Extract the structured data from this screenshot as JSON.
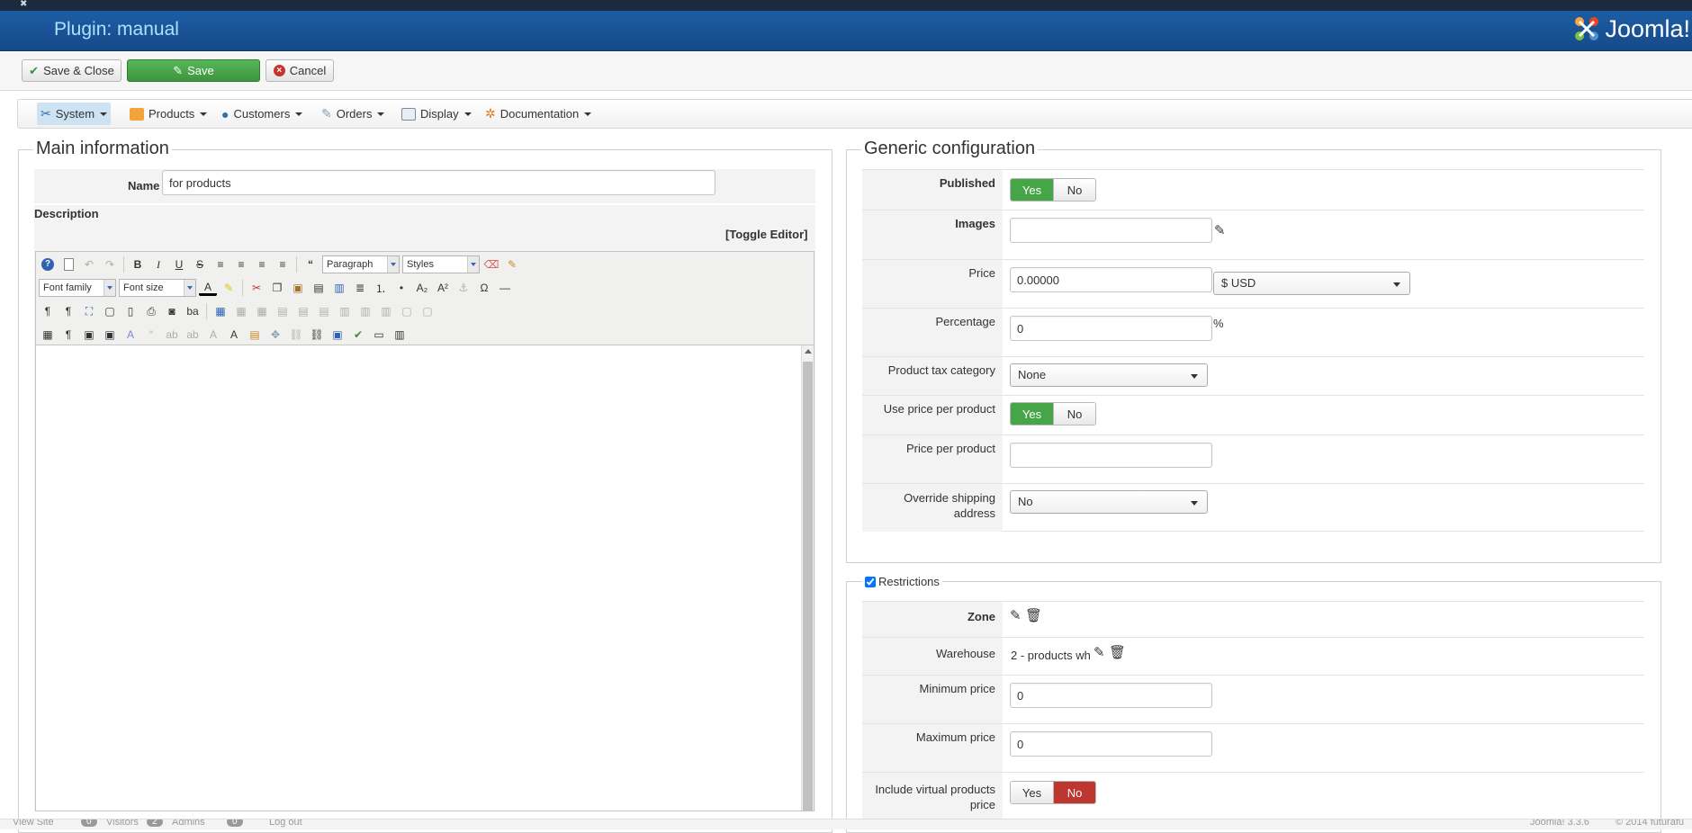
{
  "header": {
    "title": "Plugin: manual",
    "logo_text": "Joomla!"
  },
  "toolbar": {
    "save_close_label": "Save & Close",
    "save_label": "Save",
    "cancel_label": "Cancel"
  },
  "menu": {
    "items": [
      {
        "label": "System",
        "icon": "system-icon"
      },
      {
        "label": "Products",
        "icon": "products-icon"
      },
      {
        "label": "Customers",
        "icon": "customers-icon"
      },
      {
        "label": "Orders",
        "icon": "orders-icon"
      },
      {
        "label": "Display",
        "icon": "display-icon"
      },
      {
        "label": "Documentation",
        "icon": "documentation-icon"
      }
    ]
  },
  "main_info": {
    "legend": "Main information",
    "name_label": "Name",
    "name_value": "for products",
    "description_label": "Description",
    "toggle_editor": "[Toggle Editor]",
    "editor": {
      "format_value": "Paragraph",
      "styles_value": "Styles",
      "font_family_value": "Font family",
      "font_size_value": "Font size"
    }
  },
  "generic": {
    "legend": "Generic configuration",
    "published_label": "Published",
    "yes": "Yes",
    "no": "No",
    "images_label": "Images",
    "price_label": "Price",
    "price_value": "0.00000",
    "currency_value": "$ USD",
    "percentage_label": "Percentage",
    "percentage_value": "0",
    "percent_sign": "%",
    "tax_label": "Product tax category",
    "tax_value": "None",
    "use_ppp_label": "Use price per product",
    "ppp_label": "Price per product",
    "override_label": "Override shipping address",
    "override_value": "No"
  },
  "restrictions": {
    "legend": "Restrictions",
    "zone_label": "Zone",
    "warehouse_label": "Warehouse",
    "warehouse_value": "2 - products wh",
    "min_price_label": "Minimum price",
    "min_price_value": "0",
    "max_price_label": "Maximum price",
    "max_price_value": "0",
    "include_virtual_label": "Include virtual products price",
    "yes": "Yes",
    "no": "No"
  },
  "footer": {
    "view_site": "View Site",
    "visitors_count": "0",
    "visitors": "Visitors",
    "admins_count": "2",
    "admins": "Admins",
    "messages_count": "0",
    "logout": "Log out",
    "version": "Joomla! 3.3.6",
    "copyright": "© 2014 futurafu"
  },
  "colors": {
    "header_blue": "#1d5da3",
    "title_text": "#aee0ff",
    "save_green": "#46a546",
    "no_red": "#bd362f"
  }
}
